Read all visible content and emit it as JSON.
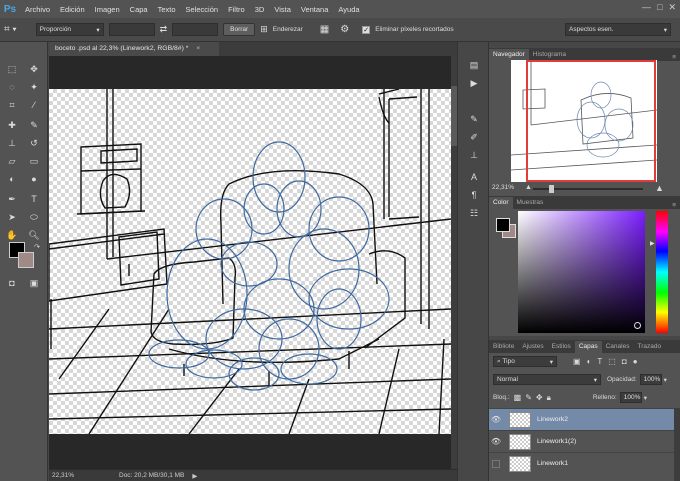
{
  "app": {
    "logo": "Ps"
  },
  "menu": [
    "Archivo",
    "Edición",
    "Imagen",
    "Capa",
    "Texto",
    "Selección",
    "Filtro",
    "3D",
    "Vista",
    "Ventana",
    "Ayuda"
  ],
  "window_controls": {
    "minimize": "—",
    "maximize": "□",
    "close": "✕"
  },
  "options": {
    "style_value": "Proporción",
    "swap": "⇄",
    "clear_label": "Borrar",
    "straighten_label": "Enderezar",
    "delete_cropped_label": "Eliminar píxeles recortados",
    "delete_cropped_checked": "✓",
    "view_value": "Aspectos esen."
  },
  "document": {
    "tab_title": "boceto .psd al 22,3% (Linework2, RGB/8#) *",
    "close": "×"
  },
  "status": {
    "zoom": "22,31%",
    "doc": "Doc: 20,2 MB/30,1 MB",
    "arrow": "▶"
  },
  "colors": {
    "foreground": "#000000",
    "background": "#a08a86",
    "accent": "#e23b3b"
  },
  "navigator": {
    "tabs": [
      "Navegador",
      "Histograma"
    ],
    "zoom": "22,31%"
  },
  "color_panel": {
    "tabs": [
      "Color",
      "Muestras"
    ]
  },
  "layers_panel": {
    "tabs": [
      "Bibliote",
      "Ajustes",
      "Estilos",
      "Capas",
      "Canales",
      "Trazado"
    ],
    "filter_label": "Tipo",
    "blend_mode": "Normal",
    "opacity_label": "Opacidad:",
    "opacity_value": "100%",
    "lock_label": "Bloq.:",
    "fill_label": "Relleno:",
    "fill_value": "100%",
    "layers": [
      {
        "name": "Linework2",
        "visible": "👁"
      },
      {
        "name": "Linework1(2)",
        "visible": "👁"
      },
      {
        "name": "Linework1",
        "visible": ""
      }
    ]
  }
}
